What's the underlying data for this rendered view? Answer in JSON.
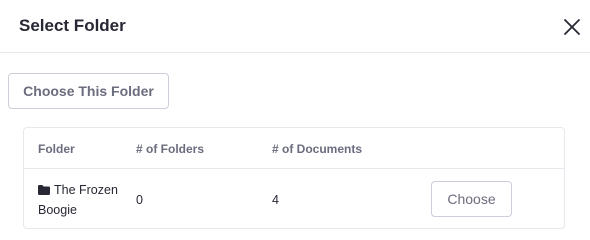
{
  "modal": {
    "title": "Select Folder",
    "close_icon": "close-icon"
  },
  "actions": {
    "choose_this_folder_label": "Choose This Folder"
  },
  "table": {
    "columns": [
      "Folder",
      "# of Folders",
      "# of Documents"
    ],
    "rows": [
      {
        "icon": "folder-icon",
        "name": "The Frozen Boogie",
        "folders": "0",
        "documents": "4",
        "action_label": "Choose"
      }
    ]
  }
}
